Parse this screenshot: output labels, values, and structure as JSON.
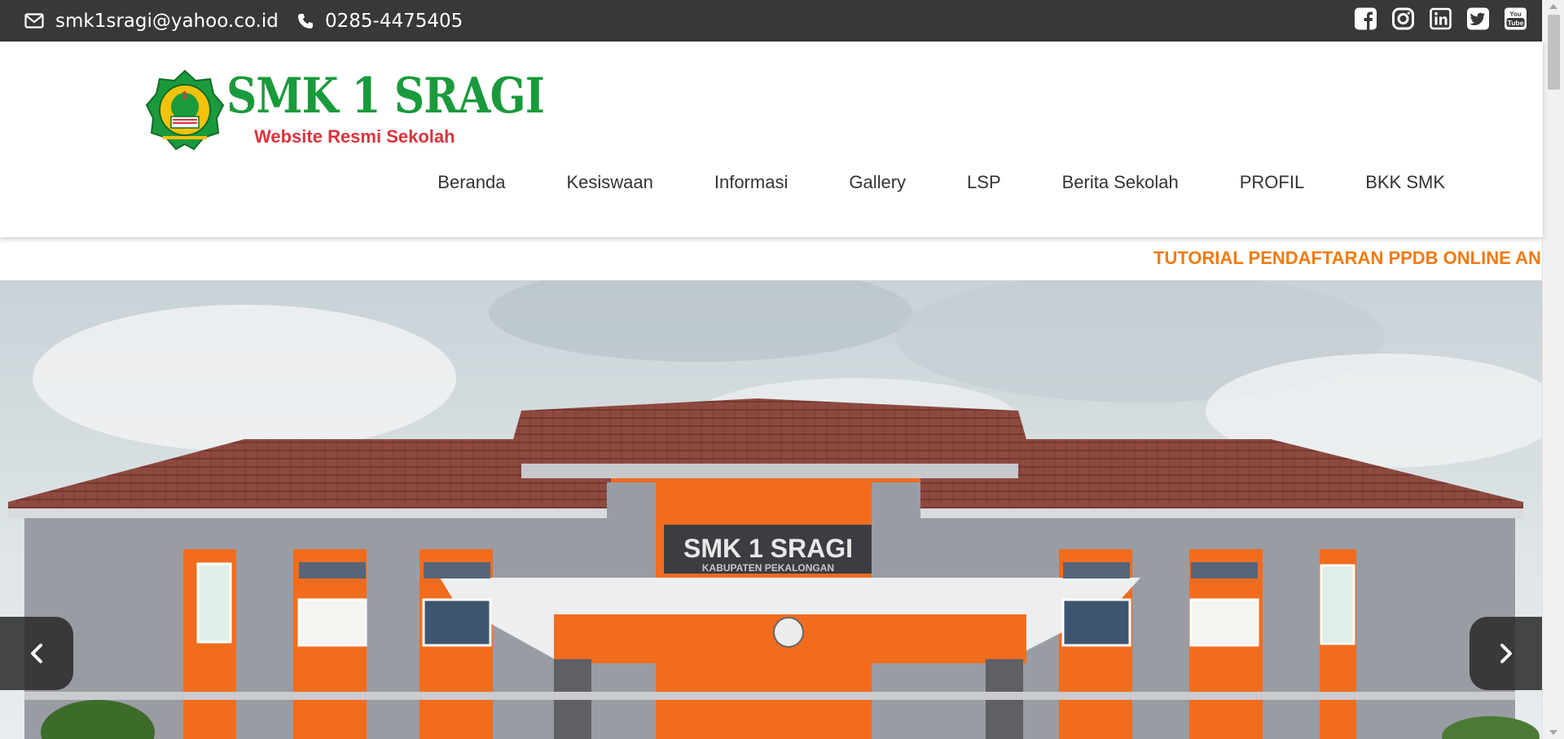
{
  "topbar": {
    "email": "smk1sragi@yahoo.co.id",
    "phone": "0285-4475405",
    "social_icons": [
      "facebook-icon",
      "instagram-icon",
      "linkedin-icon",
      "twitter-icon",
      "youtube-icon"
    ],
    "background": "#383838"
  },
  "header": {
    "brand_name": "SMK 1 SRAGI",
    "brand_tagline": "Website Resmi Sekolah",
    "brand_color": "#1a9a3c",
    "tagline_color": "#d8343c"
  },
  "nav": {
    "items": [
      {
        "label": "Beranda"
      },
      {
        "label": "Kesiswaan"
      },
      {
        "label": "Informasi"
      },
      {
        "label": "Gallery"
      },
      {
        "label": "LSP"
      },
      {
        "label": "Berita Sekolah"
      },
      {
        "label": "PROFIL"
      },
      {
        "label": "BKK SMK"
      }
    ]
  },
  "ticker": {
    "text": "TUTORIAL PENDAFTARAN PPDB ONLINE AND",
    "color": "#f47a0f"
  },
  "hero": {
    "building_sign": "SMK 1 SRAGI",
    "building_subsign": "KABUPATEN PEKALONGAN",
    "prev_icon": "chevron-left-icon",
    "next_icon": "chevron-right-icon"
  }
}
